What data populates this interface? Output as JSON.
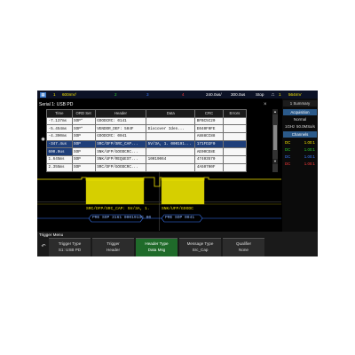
{
  "topbar": {
    "channels": [
      {
        "num": "1",
        "value": "600mV/",
        "color": "#f5e400"
      },
      {
        "num": "2",
        "value": "",
        "color": "#2fd32f"
      },
      {
        "num": "3",
        "value": "",
        "color": "#3b7bff"
      },
      {
        "num": "4",
        "value": "",
        "color": "#ff3b3b"
      }
    ],
    "timebase": "240.0us/",
    "delay": "300.0us",
    "run_status": "Stop",
    "trigger_icon": "trigger-edge-icon",
    "trigger_source": "1",
    "trigger_level": "564mV"
  },
  "left_panel": {
    "title": "Serial 1: USB PD",
    "table": {
      "headers": [
        "Time",
        "ORD Set",
        "Header",
        "Data",
        "CRC",
        "Errors"
      ],
      "rows": [
        {
          "time": "-7.137ms",
          "ord": "SOP*",
          "header": "GOODCRC: 0141",
          "data": "",
          "crc": "BFBC5C20",
          "errors": ""
        },
        {
          "time": "-5.454ms",
          "ord": "SOP*",
          "header": "VENDOR_DEF: 504F",
          "data": "Discover Iden...",
          "crc": "E040F0FE",
          "errors": ""
        },
        {
          "time": "-4.390ms",
          "ord": "SOP",
          "header": "GOODCRC: 0041",
          "data": "",
          "crc": "A888CC88",
          "errors": ""
        },
        {
          "time": "-347.4us",
          "ord": "SOP",
          "header": "SRC/DFP/SRC_CAP...",
          "data": "5V/3A, 1. 000191...",
          "crc": "171FD2F0",
          "errors": ""
        },
        {
          "time": "600.0us",
          "ord": "SOP",
          "header": "SNK/UFP/GOODCRC...",
          "data": "",
          "crc": "AE00CE8E",
          "errors": ""
        },
        {
          "time": "1.645ms",
          "ord": "SOP",
          "header": "SNK/UFP/REQUEST...",
          "data": "10019064",
          "crc": "47403570",
          "errors": ""
        },
        {
          "time": "2.355ms",
          "ord": "SOP",
          "header": "SRC/DFP/GOODCRC...",
          "data": "",
          "crc": "4A50700F",
          "errors": ""
        }
      ],
      "selected_row": 3
    }
  },
  "waveform": {
    "decode_labels": [
      "SRC/DFP/SRC_CAP: 5V/3A, 1.",
      "SNK/UFP/GOODC"
    ],
    "bus_labels": [
      "PRE  SOP  3161  0001913C  00",
      "PRE  SOP  0041"
    ]
  },
  "side_panel": {
    "tab_number": "1",
    "tab_label": "Summary",
    "acquisition_title": "Acquisition",
    "acq_mode": "Normal",
    "acq_rate_a": "1GHz",
    "acq_rate_b": "50.0MSa/s",
    "channels_title": "Channels",
    "channels": [
      {
        "name": "DC",
        "value": "1.00:1",
        "color": "#f5e400"
      },
      {
        "name": "DC",
        "value": "1.00:1",
        "color": "#2fd32f"
      },
      {
        "name": "DC",
        "value": "1.00:1",
        "color": "#3b7bff"
      },
      {
        "name": "DC",
        "value": "1.00:1",
        "color": "#ff3b3b"
      }
    ]
  },
  "menu": {
    "title": "Trigger Menu",
    "softkeys": [
      {
        "line1": "Trigger Type",
        "line2": "S1: USB PD",
        "active": false
      },
      {
        "line1": "Trigger",
        "line2": "Header",
        "active": false
      },
      {
        "line1": "Header Type",
        "line2": "Data Msg",
        "active": true
      },
      {
        "line1": "Message Type",
        "line2": "Src_Cap",
        "active": false
      },
      {
        "line1": "Qualifier",
        "line2": "None",
        "active": false
      }
    ]
  }
}
